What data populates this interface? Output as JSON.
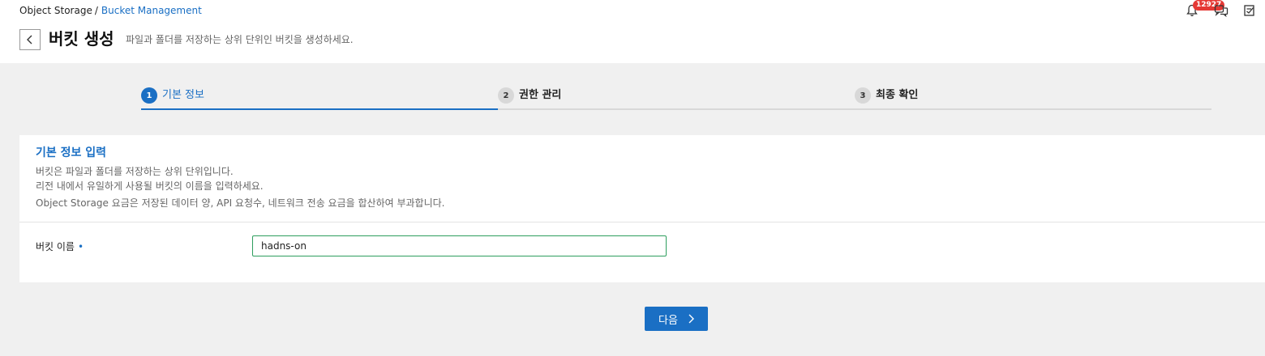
{
  "breadcrumb": {
    "root": "Object Storage",
    "separator": "/",
    "current": "Bucket Management"
  },
  "header": {
    "notification_count": "12927",
    "icons": [
      "bell-icon",
      "chat-icon",
      "memo-icon"
    ]
  },
  "page": {
    "title": "버킷 생성",
    "description": "파일과 폴더를 저장하는 상위 단위인 버킷을 생성하세요."
  },
  "steps": [
    {
      "number": "1",
      "label": "기본 정보",
      "active": true
    },
    {
      "number": "2",
      "label": "권한 관리",
      "active": false
    },
    {
      "number": "3",
      "label": "최종 확인",
      "active": false
    }
  ],
  "card": {
    "title": "기본 정보 입력",
    "desc_lines": [
      "버킷은 파일과 폴더를 저장하는 상위 단위입니다.",
      "리전 내에서 유일하게 사용될 버킷의 이름을 입력하세요.",
      "Object Storage 요금은 저장된 데이터 양, API 요청수, 네트워크 전송 요금을 합산하여 부과합니다."
    ],
    "field": {
      "label": "버킷 이름",
      "required_mark": "•",
      "value": "hadns-on"
    }
  },
  "footer": {
    "next_label": "다음"
  },
  "colors": {
    "accent": "#1a6fc4",
    "badge": "#e53935",
    "input_focus": "#2e9e5e"
  }
}
